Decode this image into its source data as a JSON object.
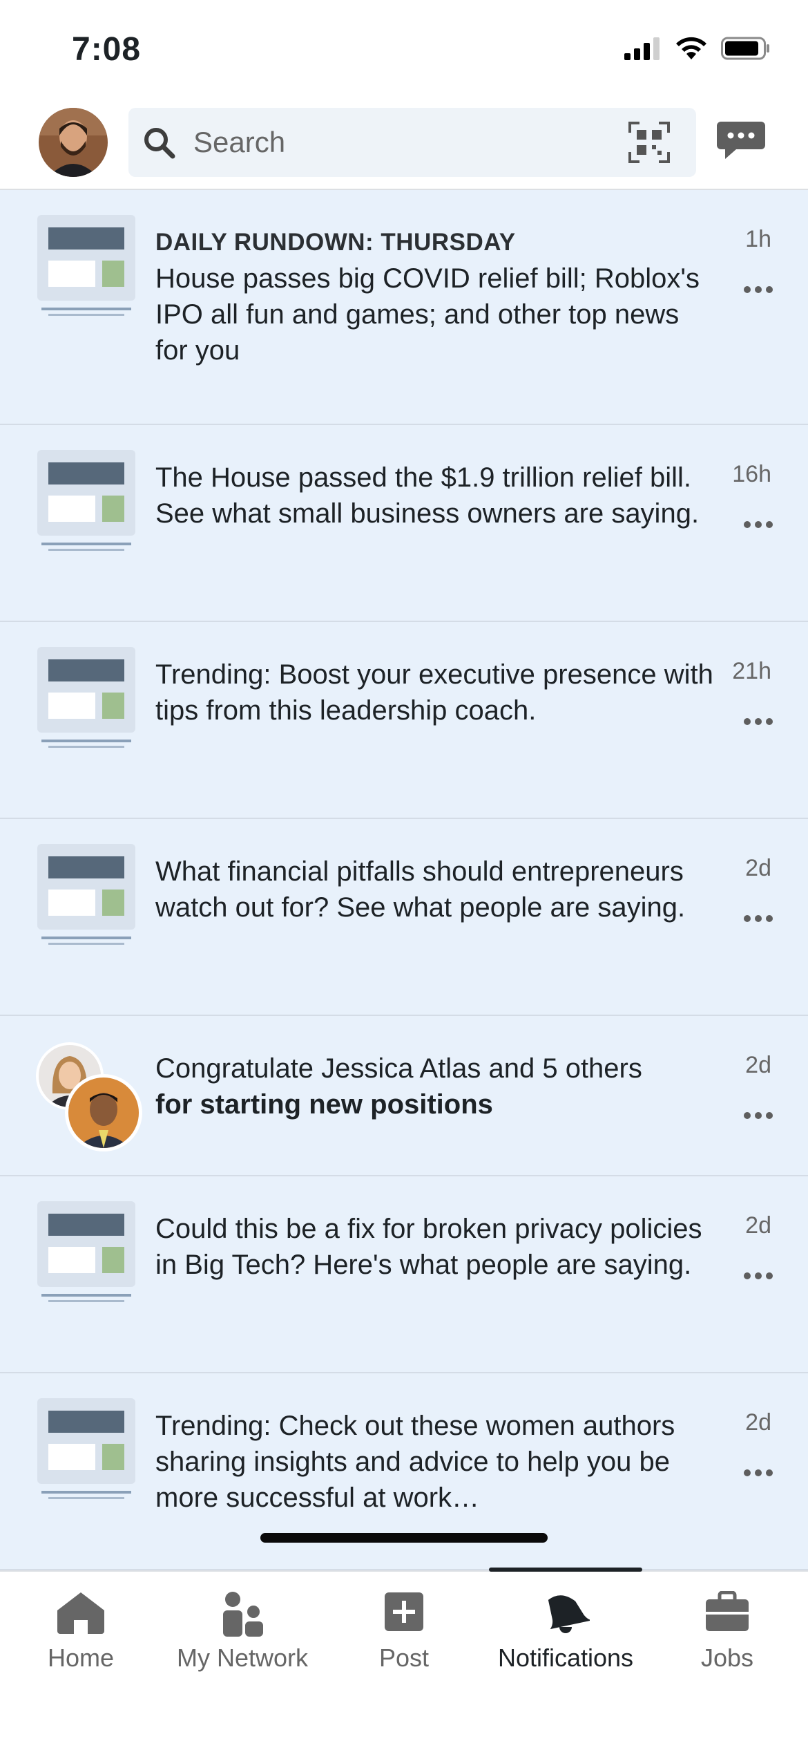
{
  "status_bar": {
    "time": "7:08"
  },
  "search": {
    "placeholder": "Search"
  },
  "notifications": [
    {
      "header": "DAILY RUNDOWN: THURSDAY",
      "text": "House passes big COVID relief bill; Roblox's IPO all fun and games; and other top news for you",
      "time": "1h"
    },
    {
      "text": "The House passed the $1.9 trillion relief bill. See what small business owners are saying.",
      "time": "16h"
    },
    {
      "text": "Trending: Boost your executive presence with tips from this leadership coach.",
      "time": "21h"
    },
    {
      "text": "What financial pitfalls should entrepreneurs watch out for? See what people are saying.",
      "time": "2d"
    },
    {
      "text": "Congratulate Jessica Atlas and 5 others",
      "text_bold": "for starting new positions",
      "time": "2d"
    },
    {
      "text": "Could this be a fix for broken privacy policies in Big Tech? Here's what people are saying.",
      "time": "2d"
    },
    {
      "text": "Trending: Check out these women authors sharing insights and advice to help you be more successful at work…",
      "time": "2d"
    }
  ],
  "bottom_nav": [
    {
      "label": "Home",
      "icon": "home-icon"
    },
    {
      "label": "My Network",
      "icon": "network-icon"
    },
    {
      "label": "Post",
      "icon": "post-icon"
    },
    {
      "label": "Notifications",
      "icon": "bell-icon",
      "active": true
    },
    {
      "label": "Jobs",
      "icon": "briefcase-icon"
    }
  ],
  "colors": {
    "feed_background": "#e8f1fb",
    "text": "#1d2226",
    "muted": "#666666"
  }
}
